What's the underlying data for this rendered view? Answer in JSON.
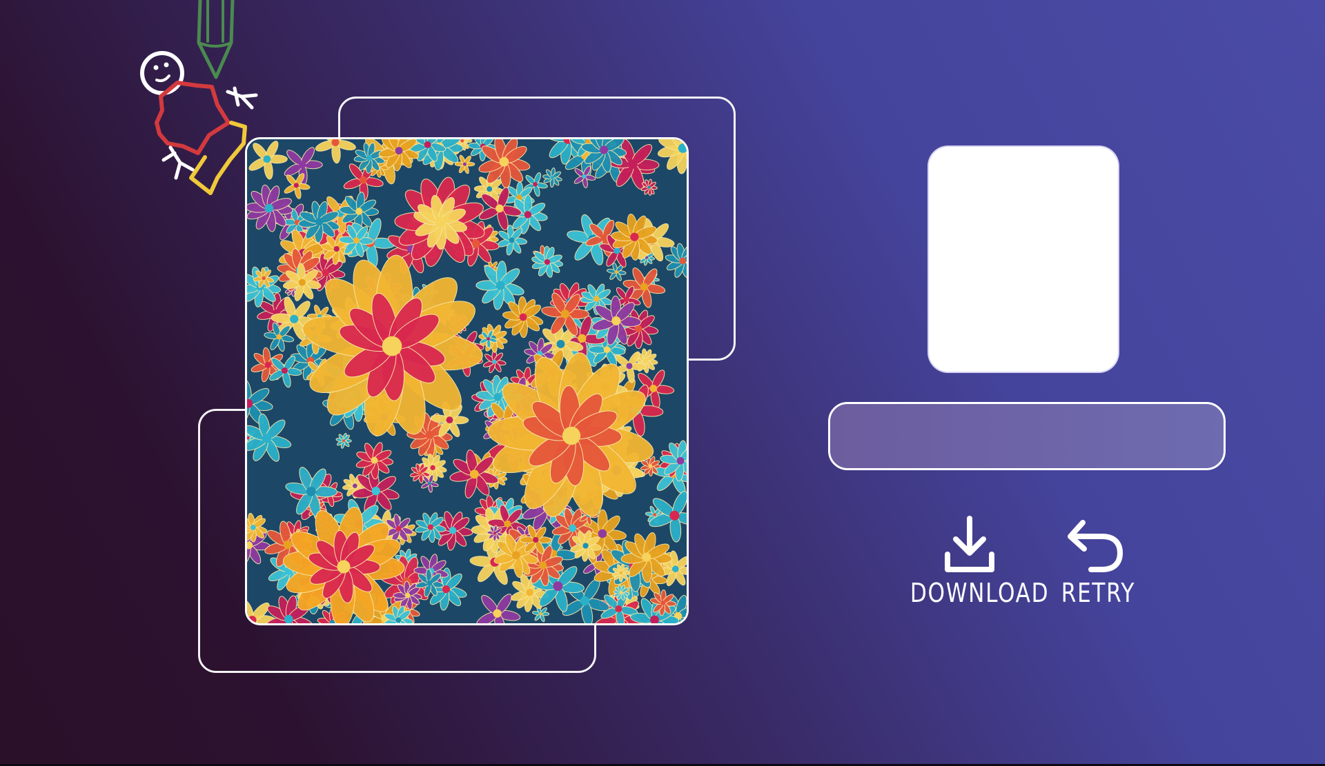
{
  "artwork": {
    "description_icon": "floral-embroidery-image"
  },
  "logo": {
    "icon": "pencil-stick-figure-logo"
  },
  "actions": {
    "download_label": "DOWNLOAD",
    "download_icon": "download-icon",
    "retry_label": "RETRY",
    "retry_icon": "undo-arrow-icon"
  },
  "colors": {
    "background_start": "#2b1029",
    "background_end": "#4a4ba6",
    "prompt_field_fill": "#6c64a8",
    "frame_stroke": "#ffffff"
  }
}
